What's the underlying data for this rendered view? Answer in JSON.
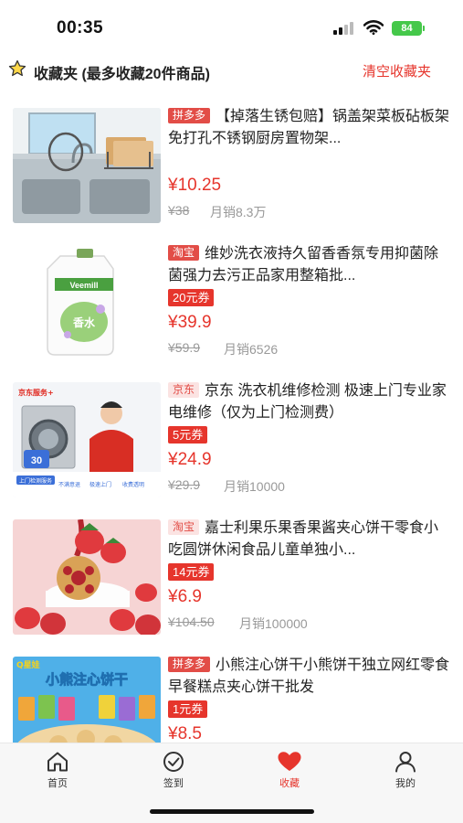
{
  "status": {
    "time": "00:35",
    "battery": "84"
  },
  "header": {
    "title": "收藏夹 (最多收藏20件商品)",
    "clear_label": "清空收藏夹"
  },
  "items": [
    {
      "platform": "拼多多",
      "title": "【掉落生锈包赔】锅盖架菜板砧板架免打孔不锈钢厨房置物架...",
      "coupon": "",
      "price": "¥10.25",
      "original_price": "¥38",
      "sales": "月销8.3万"
    },
    {
      "platform": "淘宝",
      "title": "维妙洗衣液持久留香香氛专用抑菌除菌强力去污正品家用整箱批...",
      "coupon": "20元券",
      "price": "¥39.9",
      "original_price": "¥59.9",
      "sales": "月销6526"
    },
    {
      "platform": "京东",
      "title": "京东 洗衣机维修检测 极速上门专业家电维修（仅为上门检测费）",
      "coupon": "5元券",
      "price": "¥24.9",
      "original_price": "¥29.9",
      "sales": "月销10000"
    },
    {
      "platform": "淘宝",
      "title": "嘉士利果乐果香果酱夹心饼干零食小吃圆饼休闲食品儿童单独小...",
      "coupon": "14元券",
      "price": "¥6.9",
      "original_price": "¥104.50",
      "sales": "月销100000"
    },
    {
      "platform": "拼多多",
      "title": "小熊注心饼干小熊饼干独立网红零食早餐糕点夹心饼干批发",
      "coupon": "1元券",
      "price": "¥8.5",
      "original_price": "",
      "sales": ""
    }
  ],
  "thumb_text": {
    "jd_brand": "京东服务+",
    "jd_price": "30",
    "jd_banner": "上门检测服务",
    "jd_tags": [
      "不满意退",
      "极速上门",
      "收费透明"
    ],
    "detergent_brand": "Veemill",
    "detergent_label": "香水",
    "cookie_banner": "小熊注心饼干",
    "cookie_logo": "Q星娃"
  },
  "tabs": [
    {
      "label": "首页",
      "icon": "home-icon",
      "active": false
    },
    {
      "label": "签到",
      "icon": "check-circle-icon",
      "active": false
    },
    {
      "label": "收藏",
      "icon": "heart-icon",
      "active": true
    },
    {
      "label": "我的",
      "icon": "user-icon",
      "active": false
    }
  ],
  "colors": {
    "accent": "#e6352c",
    "muted": "#999999",
    "tabbar_bg": "#f7f7f7"
  }
}
